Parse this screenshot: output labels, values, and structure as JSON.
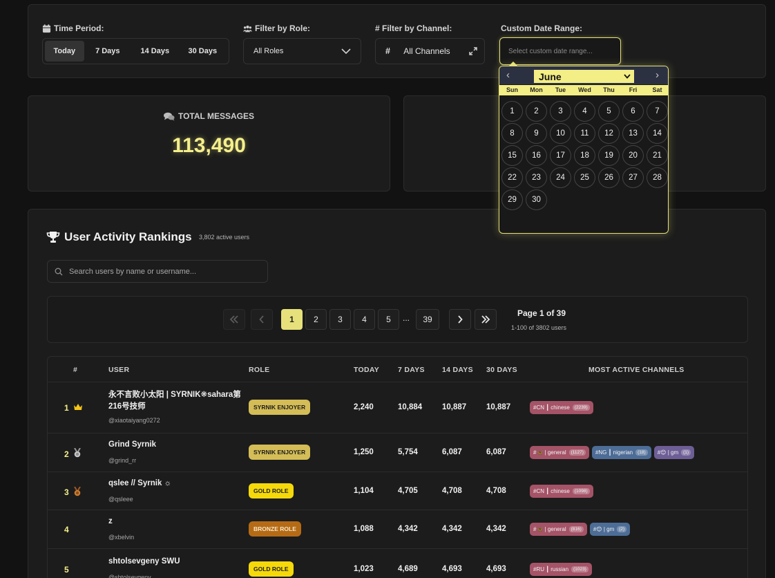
{
  "filters": {
    "time_period": {
      "label": "Time Period:",
      "options": [
        "Today",
        "7 Days",
        "14 Days",
        "30 Days"
      ],
      "active": "Today"
    },
    "role": {
      "label": "Filter by Role:",
      "value": "All Roles"
    },
    "channel": {
      "label": "# Filter by Channel:",
      "value": "All Channels"
    },
    "date_range": {
      "label": "Custom Date Range:",
      "placeholder": "Select custom date range..."
    }
  },
  "stats": {
    "total_messages_label": "TOTAL MESSAGES",
    "total_messages": "113,490"
  },
  "rankings": {
    "title": "User Activity Rankings",
    "active_users": "3,802 active users",
    "search_placeholder": "Search users by name or username...",
    "pagination": {
      "pages": [
        "1",
        "2",
        "3",
        "4",
        "5",
        "...",
        "39"
      ],
      "current": "1",
      "page_info": "Page 1 of 39",
      "range_info": "1-100 of 3802 users"
    },
    "columns": [
      "#",
      "USER",
      "ROLE",
      "TODAY",
      "7 DAYS",
      "14 DAYS",
      "30 DAYS",
      "MOST ACTIVE CHANNELS"
    ],
    "rows": [
      {
        "rank": "1",
        "badge": "crown-icon",
        "name": "永不言败小太阳 | SYRNIK❋sahara第216号技师",
        "handle": "@xiaotaiyang0272",
        "role": "SYRNIK ENJOYER",
        "role_type": "syr",
        "today": "2,240",
        "d7": "10,884",
        "d14": "10,887",
        "d30": "10,887",
        "channels": [
          {
            "text": "#CN ┃ chinese",
            "count": "(2239)",
            "color": "red"
          }
        ]
      },
      {
        "rank": "2",
        "badge": "silver-medal-icon",
        "name": "Grind Syrnik",
        "handle": "@grind_rr",
        "role": "SYRNIK ENJOYER",
        "role_type": "syr",
        "today": "1,250",
        "d7": "5,754",
        "d14": "6,087",
        "d30": "6,087",
        "channels": [
          {
            "text": "#🦋 | general",
            "count": "(1127)",
            "color": "red"
          },
          {
            "text": "#NG ┃ nigerian",
            "count": "(18)",
            "color": "blue"
          },
          {
            "text": "#😊 | gm",
            "count": "(1)",
            "color": "purple"
          }
        ]
      },
      {
        "rank": "3",
        "badge": "bronze-medal-icon",
        "name": "qslee // Syrnik ☼",
        "handle": "@qsleee",
        "role": "GOLD ROLE",
        "role_type": "gold",
        "today": "1,104",
        "d7": "4,705",
        "d14": "4,708",
        "d30": "4,708",
        "channels": [
          {
            "text": "#CN ┃ chinese",
            "count": "(1098)",
            "color": "red"
          }
        ]
      },
      {
        "rank": "4",
        "badge": "",
        "name": "z",
        "handle": "@xbelvin",
        "role": "BRONZE ROLE",
        "role_type": "bronze",
        "today": "1,088",
        "d7": "4,342",
        "d14": "4,342",
        "d30": "4,342",
        "channels": [
          {
            "text": "#🦋 | general",
            "count": "(816)",
            "color": "red"
          },
          {
            "text": "#😊 | gm",
            "count": "(2)",
            "color": "blue"
          }
        ]
      },
      {
        "rank": "5",
        "badge": "",
        "name": "shtolsevgeny SWU",
        "handle": "@shtolsevgeny",
        "role": "GOLD ROLE",
        "role_type": "gold",
        "today": "1,023",
        "d7": "4,689",
        "d14": "4,693",
        "d30": "4,693",
        "channels": [
          {
            "text": "#RU ┃ russian",
            "count": "(1023)",
            "color": "red"
          }
        ]
      }
    ]
  },
  "calendar": {
    "month": "June",
    "weekdays": [
      "Sun",
      "Mon",
      "Tue",
      "Wed",
      "Thu",
      "Fri",
      "Sat"
    ],
    "days": [
      "1",
      "2",
      "3",
      "4",
      "5",
      "6",
      "7",
      "8",
      "9",
      "10",
      "11",
      "12",
      "13",
      "14",
      "15",
      "16",
      "17",
      "18",
      "19",
      "20",
      "21",
      "22",
      "23",
      "24",
      "25",
      "26",
      "27",
      "28",
      "29",
      "30"
    ]
  },
  "colors": {
    "accent": "#e6e17a",
    "highlight_number": "#f4ef8a"
  }
}
